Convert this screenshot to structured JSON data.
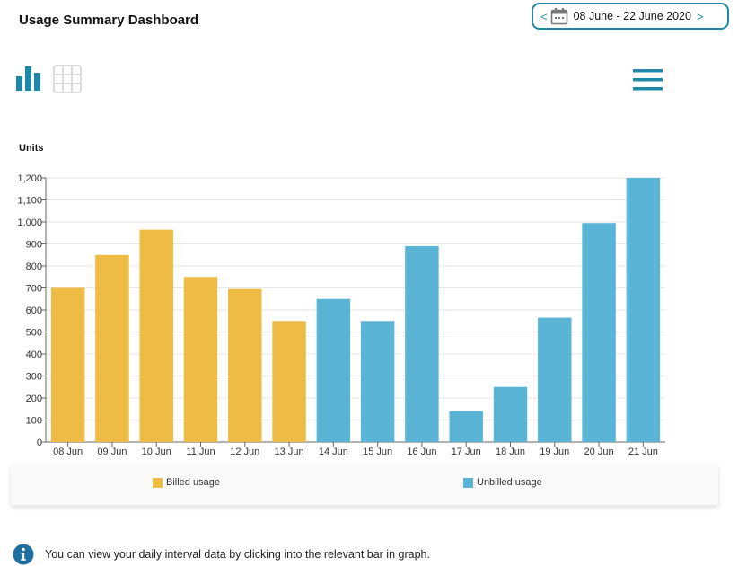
{
  "header": {
    "title": "Usage Summary Dashboard",
    "date_range": "08 June - 22 June 2020",
    "prev": "<",
    "next": ">"
  },
  "icons": {
    "bar_chart": "bar-chart-icon",
    "grid": "grid-icon",
    "menu": "hamburger-icon",
    "calendar": "calendar-icon",
    "info": "info-icon"
  },
  "colors": {
    "billed": "#EEBB44",
    "unbilled": "#5AB4D6",
    "accent": "#1F88A8"
  },
  "chart_data": {
    "type": "bar",
    "ylabel": "Units",
    "ylim": [
      0,
      1200
    ],
    "yticks": [
      "0",
      "100",
      "200",
      "300",
      "400",
      "500",
      "600",
      "700",
      "800",
      "900",
      "1,000",
      "1,100",
      "1,200"
    ],
    "categories": [
      "08 Jun",
      "09 Jun",
      "10 Jun",
      "11 Jun",
      "12 Jun",
      "13 Jun",
      "14 Jun",
      "15 Jun",
      "16 Jun",
      "17 Jun",
      "18 Jun",
      "19 Jun",
      "20 Jun",
      "21 Jun"
    ],
    "series": [
      {
        "name": "Billed usage",
        "values": [
          700,
          850,
          965,
          750,
          695,
          550,
          null,
          null,
          null,
          null,
          null,
          null,
          null,
          null
        ]
      },
      {
        "name": "Unbilled usage",
        "values": [
          null,
          null,
          null,
          null,
          null,
          null,
          650,
          550,
          890,
          140,
          250,
          565,
          995,
          1200
        ]
      }
    ],
    "grid": true,
    "legend": "bottom"
  },
  "footer": {
    "info_text": "You can view your daily interval data by clicking into the relevant bar in graph."
  }
}
